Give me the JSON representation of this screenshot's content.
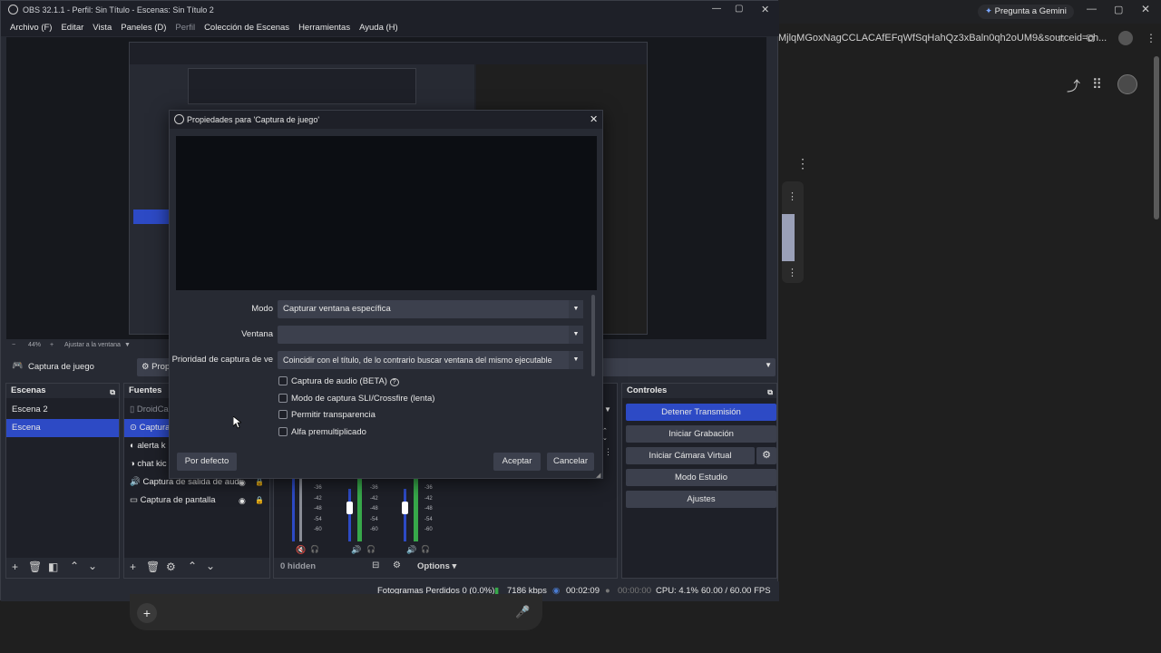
{
  "chrome": {
    "gemini_label": "Pregunta a Gemini",
    "url_fragment": "MjlqMGoxNagCCLACAfEFqWfSqHahQz3xBaln0qh2oUM9&sourceid=ch..."
  },
  "obs": {
    "title": "OBS 32.1.1 - Perfil: Sin Título - Escenas: Sin Título 2",
    "menu": [
      "Archivo (F)",
      "Editar",
      "Vista",
      "Paneles (D)",
      "Perfil",
      "Colección de Escenas",
      "Herramientas",
      "Ayuda (H)"
    ],
    "zoom": "44%",
    "fit": "Ajustar a la ventana",
    "source_bar_name": "Captura de juego",
    "source_bar_props": "Prop",
    "scenes_title": "Escenas",
    "scenes": [
      "Escena 2",
      "Escena"
    ],
    "sources_title": "Fuentes",
    "sources": [
      "DroidCa",
      "Captura",
      "alerta k",
      "chat kic",
      "Captura de salida de audi",
      "Captura de pantalla"
    ],
    "mixer_hidden": "0 hidden",
    "mixer_options": "Options",
    "mixer_ticks": [
      "-36",
      "-42",
      "-48",
      "-54",
      "-60"
    ],
    "controls_title": "Controles",
    "controls": {
      "stop_stream": "Detener Transmisión",
      "start_recording": "Iniciar Grabación",
      "virtual_cam": "Iniciar Cámara Virtual",
      "studio_mode": "Modo Estudio",
      "settings": "Ajustes"
    },
    "status": {
      "dropped": "Fotogramas Perdidos 0 (0.0%)",
      "bitrate": "7186 kbps",
      "stream_time": "00:02:09",
      "rec_time": "00:00:00",
      "cpu": "CPU: 4.1%",
      "fps": "60.00 / 60.00 FPS"
    }
  },
  "dialog": {
    "title": "Propiedades para 'Captura de juego'",
    "mode_label": "Modo",
    "mode_value": "Capturar ventana específica",
    "window_label": "Ventana",
    "window_value": "",
    "priority_label": "Prioridad de captura de ve",
    "priority_value": "Coincidir con el título, de lo contrario buscar ventana del mismo ejecutable",
    "checks": [
      "Captura de audio (BETA)",
      "Modo de captura SLI/Crossfire (lenta)",
      "Permitir transparencia",
      "Alfa premultiplicado"
    ],
    "defaults_button": "Por defecto",
    "ok_button": "Aceptar",
    "cancel_button": "Cancelar"
  }
}
